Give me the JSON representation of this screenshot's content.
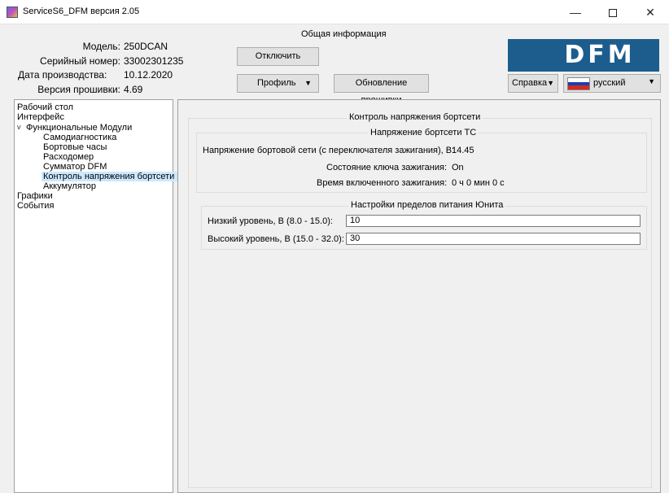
{
  "window": {
    "title": "ServiceS6_DFM версия 2.05",
    "minimize_glyph": "—",
    "close_glyph": "✕"
  },
  "header": {
    "section_title": "Общая информация",
    "model_label": "Модель:",
    "model_value": "250DCAN",
    "serial_label": "Серийный номер:",
    "serial_value": "33002301235",
    "date_label": "Дата производства:",
    "date_value": "10.12.2020",
    "firmware_label": "Версия прошивки:",
    "firmware_value": "4.69",
    "disconnect_button": "Отключить",
    "profile_button": "Профиль",
    "update_button": "Обновление прошивки",
    "help_button": "Справка",
    "language": "русский",
    "logo_text": "DFM",
    "logo_color": "#1c5d8d",
    "dropdown_glyph": "▼"
  },
  "tree": {
    "expand_glyph": "v",
    "items": [
      {
        "label": "Рабочий стол"
      },
      {
        "label": "Интерфейс"
      },
      {
        "label": "Функциональные Модули"
      },
      {
        "label": "Самодиагностика"
      },
      {
        "label": "Бортовые часы"
      },
      {
        "label": "Расходомер"
      },
      {
        "label": "Сумматор DFM"
      },
      {
        "label": "Контроль напряжения бортсети"
      },
      {
        "label": "Аккумулятор"
      },
      {
        "label": "Графики"
      },
      {
        "label": "События"
      }
    ],
    "selected_color": "#cce8ff"
  },
  "main": {
    "outer_title": "Контроль напряжения бортсети",
    "voltage_group": {
      "title": "Напряжение бортсети ТС",
      "voltage_label": "Напряжение бортовой сети (с переключателя зажигания), В:",
      "voltage_value": "14.45",
      "ignition_label": "Состояние ключа зажигания:",
      "ignition_value": "On",
      "ignition_time_label": "Время включенного зажигания:",
      "ignition_time_value": "0 ч 0 мин 0 с"
    },
    "limits_group": {
      "title": "Настройки пределов питания Юнита",
      "low_label": "Низкий уровень, В (8.0 - 15.0):",
      "low_value": "10",
      "high_label": "Высокий уровень, В (15.0 - 32.0):",
      "high_value": "30"
    }
  }
}
